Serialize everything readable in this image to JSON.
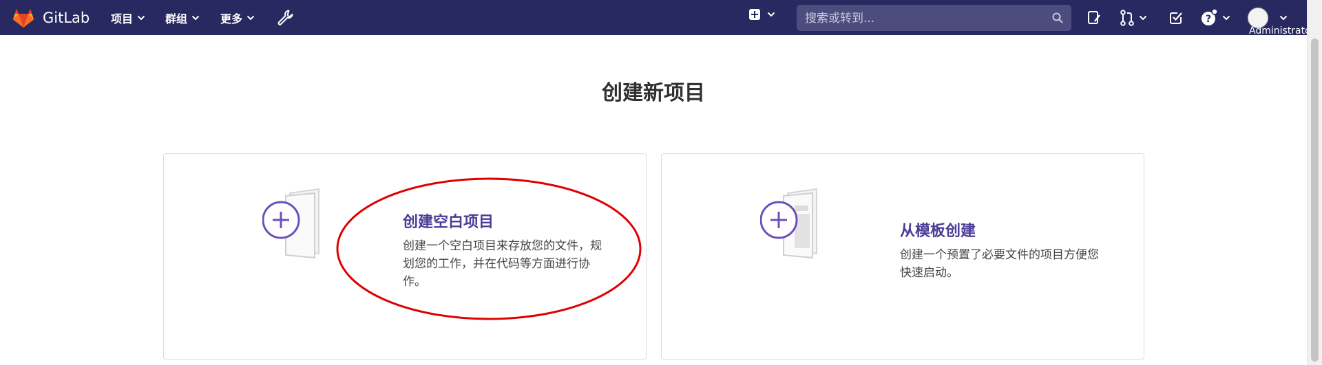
{
  "navbar": {
    "brand": "GitLab",
    "menus": [
      {
        "label": "项目"
      },
      {
        "label": "群组"
      },
      {
        "label": "更多"
      }
    ],
    "search": {
      "placeholder": "搜索或转到..."
    },
    "user": {
      "name": "Administrator"
    }
  },
  "page": {
    "title": "创建新项目"
  },
  "cards": [
    {
      "title": "创建空白项目",
      "description": "创建一个空白项目来存放您的文件，规划您的工作，并在代码等方面进行协作。"
    },
    {
      "title": "从模板创建",
      "description": "创建一个预置了必要文件的项目方便您快速启动。"
    }
  ],
  "icons": [
    "gitlab-logo-icon",
    "chevron-down-icon",
    "wrench-icon",
    "plus-square-icon",
    "search-icon",
    "issues-icon",
    "merge-request-icon",
    "todo-icon",
    "help-icon",
    "avatar-icon",
    "new-project-plus-icon"
  ],
  "colors": {
    "navbar_bg": "#292961",
    "accent": "#4b3c96",
    "plus_circle": "#6b4fbb",
    "annotation_ellipse": "#e00000"
  }
}
